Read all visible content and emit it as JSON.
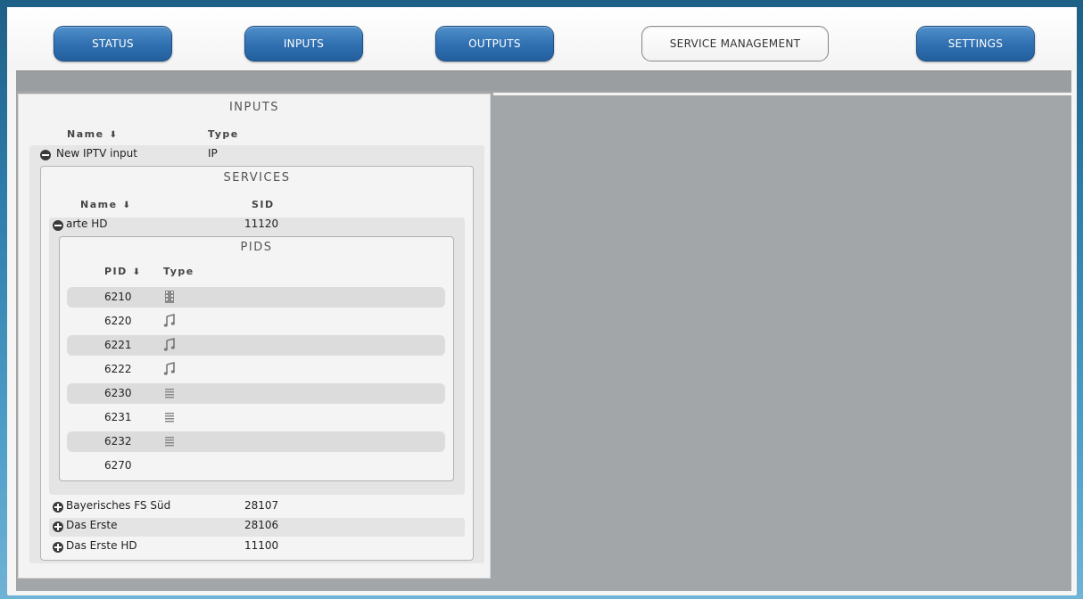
{
  "nav": {
    "status": "STATUS",
    "inputs": "INPUTS",
    "outputs": "OUTPUTS",
    "service_management": "SERVICE MANAGEMENT",
    "settings": "SETTINGS"
  },
  "inputs_panel": {
    "title": "INPUTS",
    "col_name": "Name",
    "col_type": "Type",
    "input": {
      "name": "New IPTV input",
      "type": "IP"
    },
    "services": {
      "title": "SERVICES",
      "col_name": "Name",
      "col_sid": "SID",
      "expanded_service": {
        "name": "arte HD",
        "sid": "11120",
        "pids": {
          "title": "PIDS",
          "col_pid": "PID",
          "col_type": "Type",
          "rows": [
            {
              "pid": "6210",
              "icon": "video-icon"
            },
            {
              "pid": "6220",
              "icon": "audio-icon"
            },
            {
              "pid": "6221",
              "icon": "audio-icon"
            },
            {
              "pid": "6222",
              "icon": "audio-icon"
            },
            {
              "pid": "6230",
              "icon": "text-icon"
            },
            {
              "pid": "6231",
              "icon": "text-icon"
            },
            {
              "pid": "6232",
              "icon": "text-icon"
            },
            {
              "pid": "6270",
              "icon": ""
            }
          ]
        }
      },
      "collapsed_services": [
        {
          "name": "Bayerisches FS Süd",
          "sid": "28107"
        },
        {
          "name": "Das Erste",
          "sid": "28106"
        },
        {
          "name": "Das Erste HD",
          "sid": "11100"
        }
      ]
    }
  },
  "colors": {
    "nav_button": "#2f6fb0",
    "workspace": "#a3a6a8",
    "panel": "#f3f3f3"
  }
}
